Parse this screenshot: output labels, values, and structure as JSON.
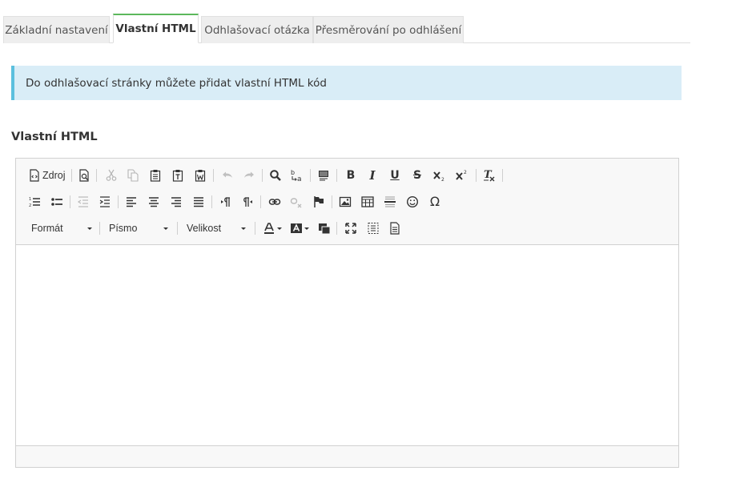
{
  "tabs": [
    {
      "label": "Základní nastavení",
      "active": false
    },
    {
      "label": "Vlastní HTML",
      "active": true
    },
    {
      "label": "Odhlašovací otázka",
      "active": false
    },
    {
      "label": "Přesměrování po odhlášení",
      "active": false
    }
  ],
  "alert": {
    "text": "Do odhlašovací stránky můžete přidat vlastní HTML kód"
  },
  "section": {
    "title": "Vlastní HTML"
  },
  "editor": {
    "toolbar": {
      "source_label": "Zdroj",
      "format_label": "Formát",
      "font_label": "Písmo",
      "size_label": "Velikost",
      "bold_glyph": "B",
      "italic_glyph": "I",
      "underline_glyph": "U",
      "strike_glyph": "S",
      "special_char_glyph": "Ω"
    },
    "content": ""
  },
  "colors": {
    "active_tab_accent": "#5cb85c",
    "alert_bg": "#d9edf7",
    "alert_border": "#5bc0de"
  }
}
